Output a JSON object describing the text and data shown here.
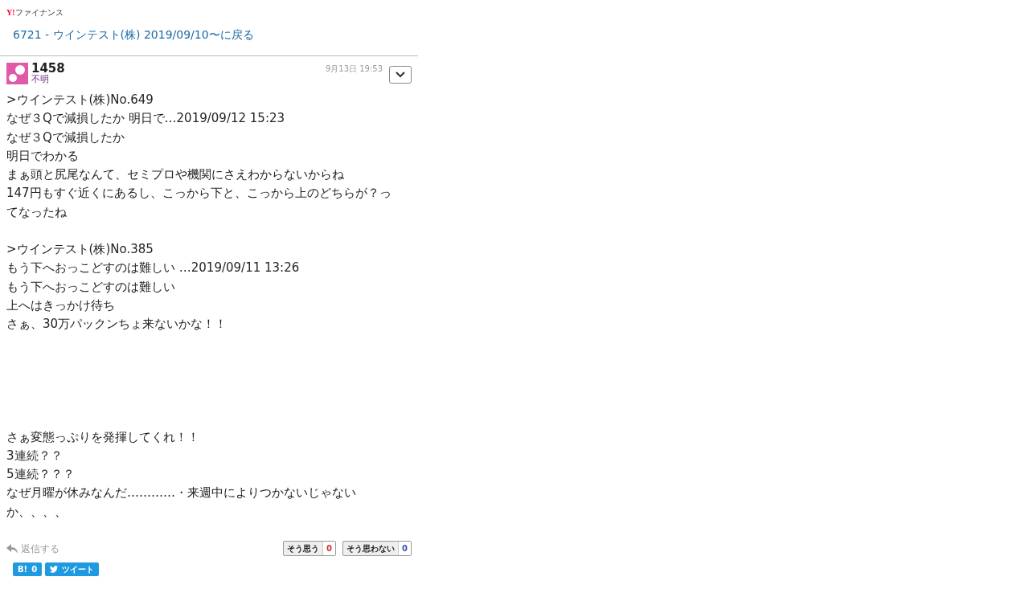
{
  "logo": {
    "mark": "Y!",
    "text": "ファイナンス"
  },
  "back_link": "6721 - ウインテスト(株) 2019/09/10〜に戻る",
  "post": {
    "user": "1458",
    "rating": "不明",
    "time": "9月13日 19:53",
    "paragraphs": [
      [
        ">ウインテスト(株)No.649",
        "なぜ３Qで減損したか 明日で…2019/09/12 15:23",
        "なぜ３Qで減損したか",
        "明日でわかる",
        "まぁ頭と尻尾なんて、セミプロや機関にさえわからないからね",
        "147円もすぐ近くにあるし、こっから下と、こっから上のどちらが？っ",
        "てなったね"
      ],
      [
        ">ウインテスト(株)No.385",
        "もう下へおっこどすのは難しい …2019/09/11 13:26",
        "もう下へおっこどすのは難しい",
        "上へはきっかけ待ち",
        "さぁ、30万パックンちょ来ないかな！！"
      ],
      [
        "さぁ変態っぷりを発揮してくれ！！",
        "3連続？？",
        "5連続？？？",
        "なぜ月曜が休みなんだ…………・来週中によりつかないじゃない",
        "か、、、、"
      ]
    ],
    "reply": "返信する",
    "votes": [
      {
        "kind": "agree",
        "label": "そう思う",
        "count": "0"
      },
      {
        "kind": "disagree",
        "label": "そう思わない",
        "count": "0"
      }
    ],
    "share": [
      {
        "kind": "hatena",
        "label": "B!",
        "count": "0"
      },
      {
        "kind": "twitter",
        "label": "ツイート"
      }
    ]
  }
}
